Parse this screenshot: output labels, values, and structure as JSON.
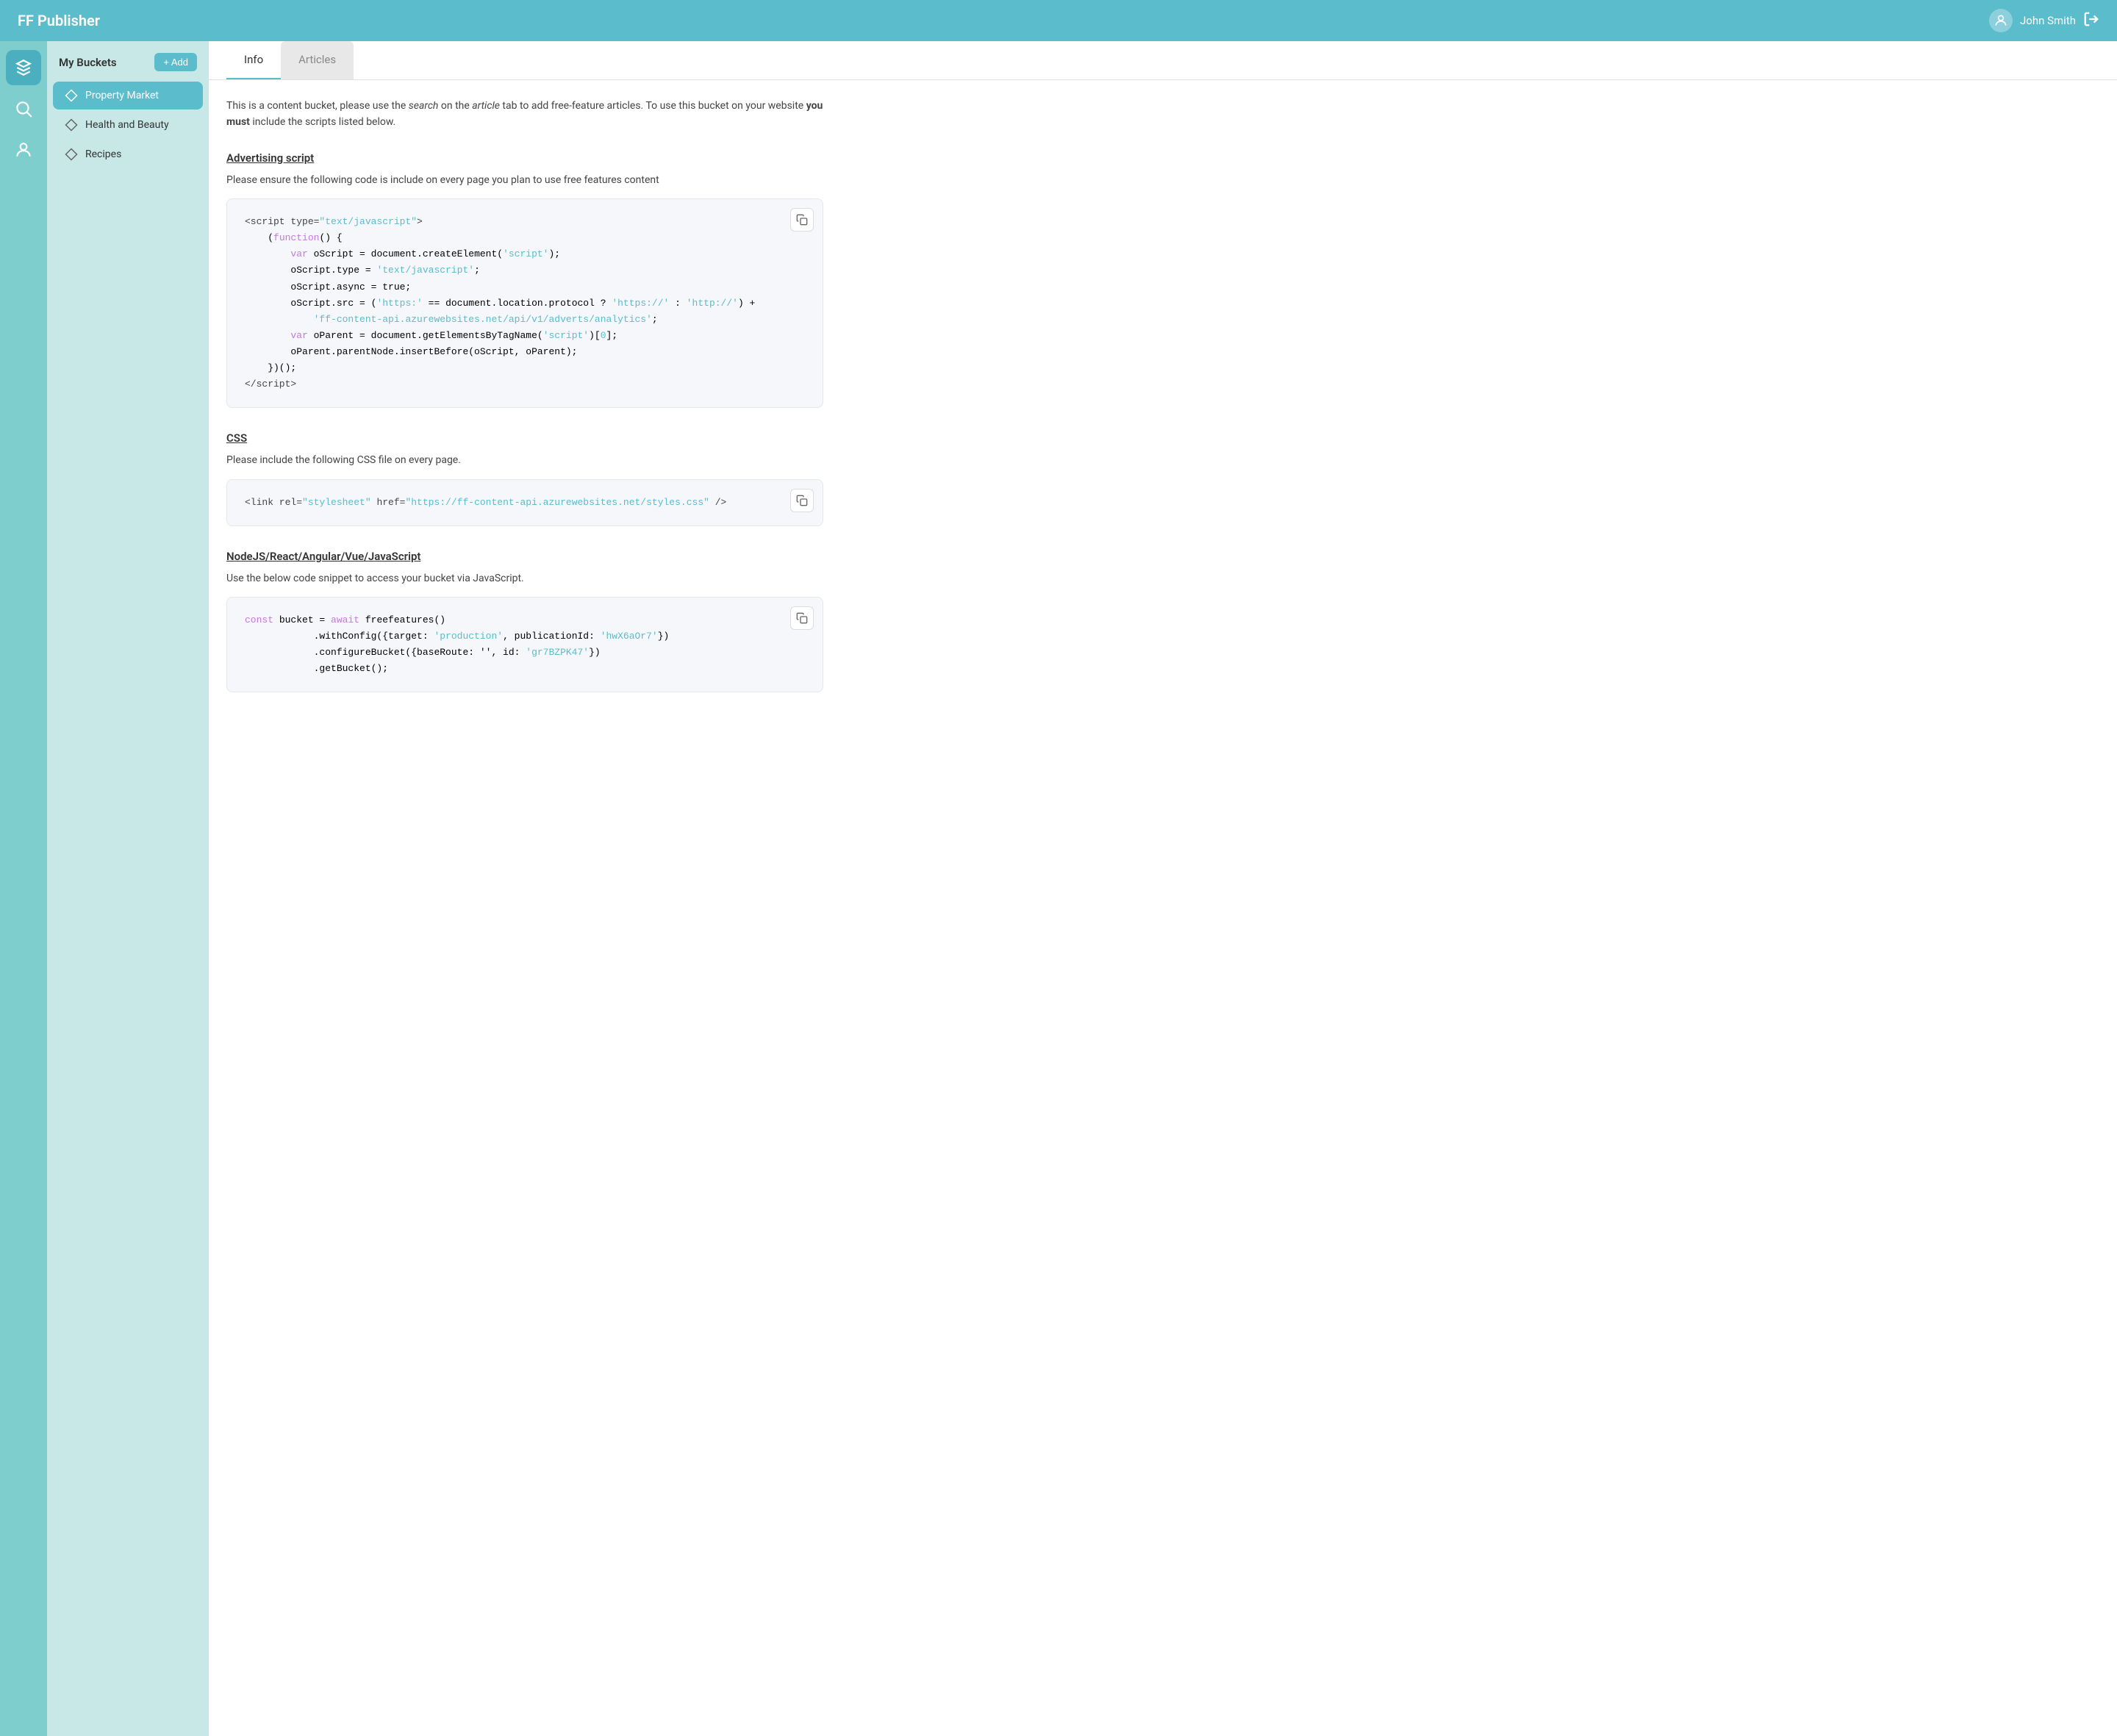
{
  "topbar": {
    "title": "FF Publisher",
    "username": "John Smith"
  },
  "sidebar": {
    "title": "My Buckets",
    "add_label": "+ Add",
    "items": [
      {
        "id": "property-market",
        "label": "Property Market",
        "active": true
      },
      {
        "id": "health-and-beauty",
        "label": "Health and Beauty",
        "active": false
      },
      {
        "id": "recipes",
        "label": "Recipes",
        "active": false
      }
    ]
  },
  "tabs": [
    {
      "id": "info",
      "label": "Info",
      "active": true
    },
    {
      "id": "articles",
      "label": "Articles",
      "active": false
    }
  ],
  "info": {
    "intro": "This is a content bucket, please use the search on the article tab to add free-feature articles. To use this bucket on your website you must include the scripts listed below.",
    "sections": [
      {
        "id": "advertising-script",
        "heading": "Advertising script",
        "desc": "Please ensure the following code is include on every page you plan to use free features content"
      },
      {
        "id": "css",
        "heading": "CSS",
        "desc": "Please include the following CSS file on every page."
      },
      {
        "id": "nodejs",
        "heading": "NodeJS/React/Angular/Vue/JavaScript",
        "desc": "Use the below code snippet to access your bucket via JavaScript."
      }
    ]
  }
}
